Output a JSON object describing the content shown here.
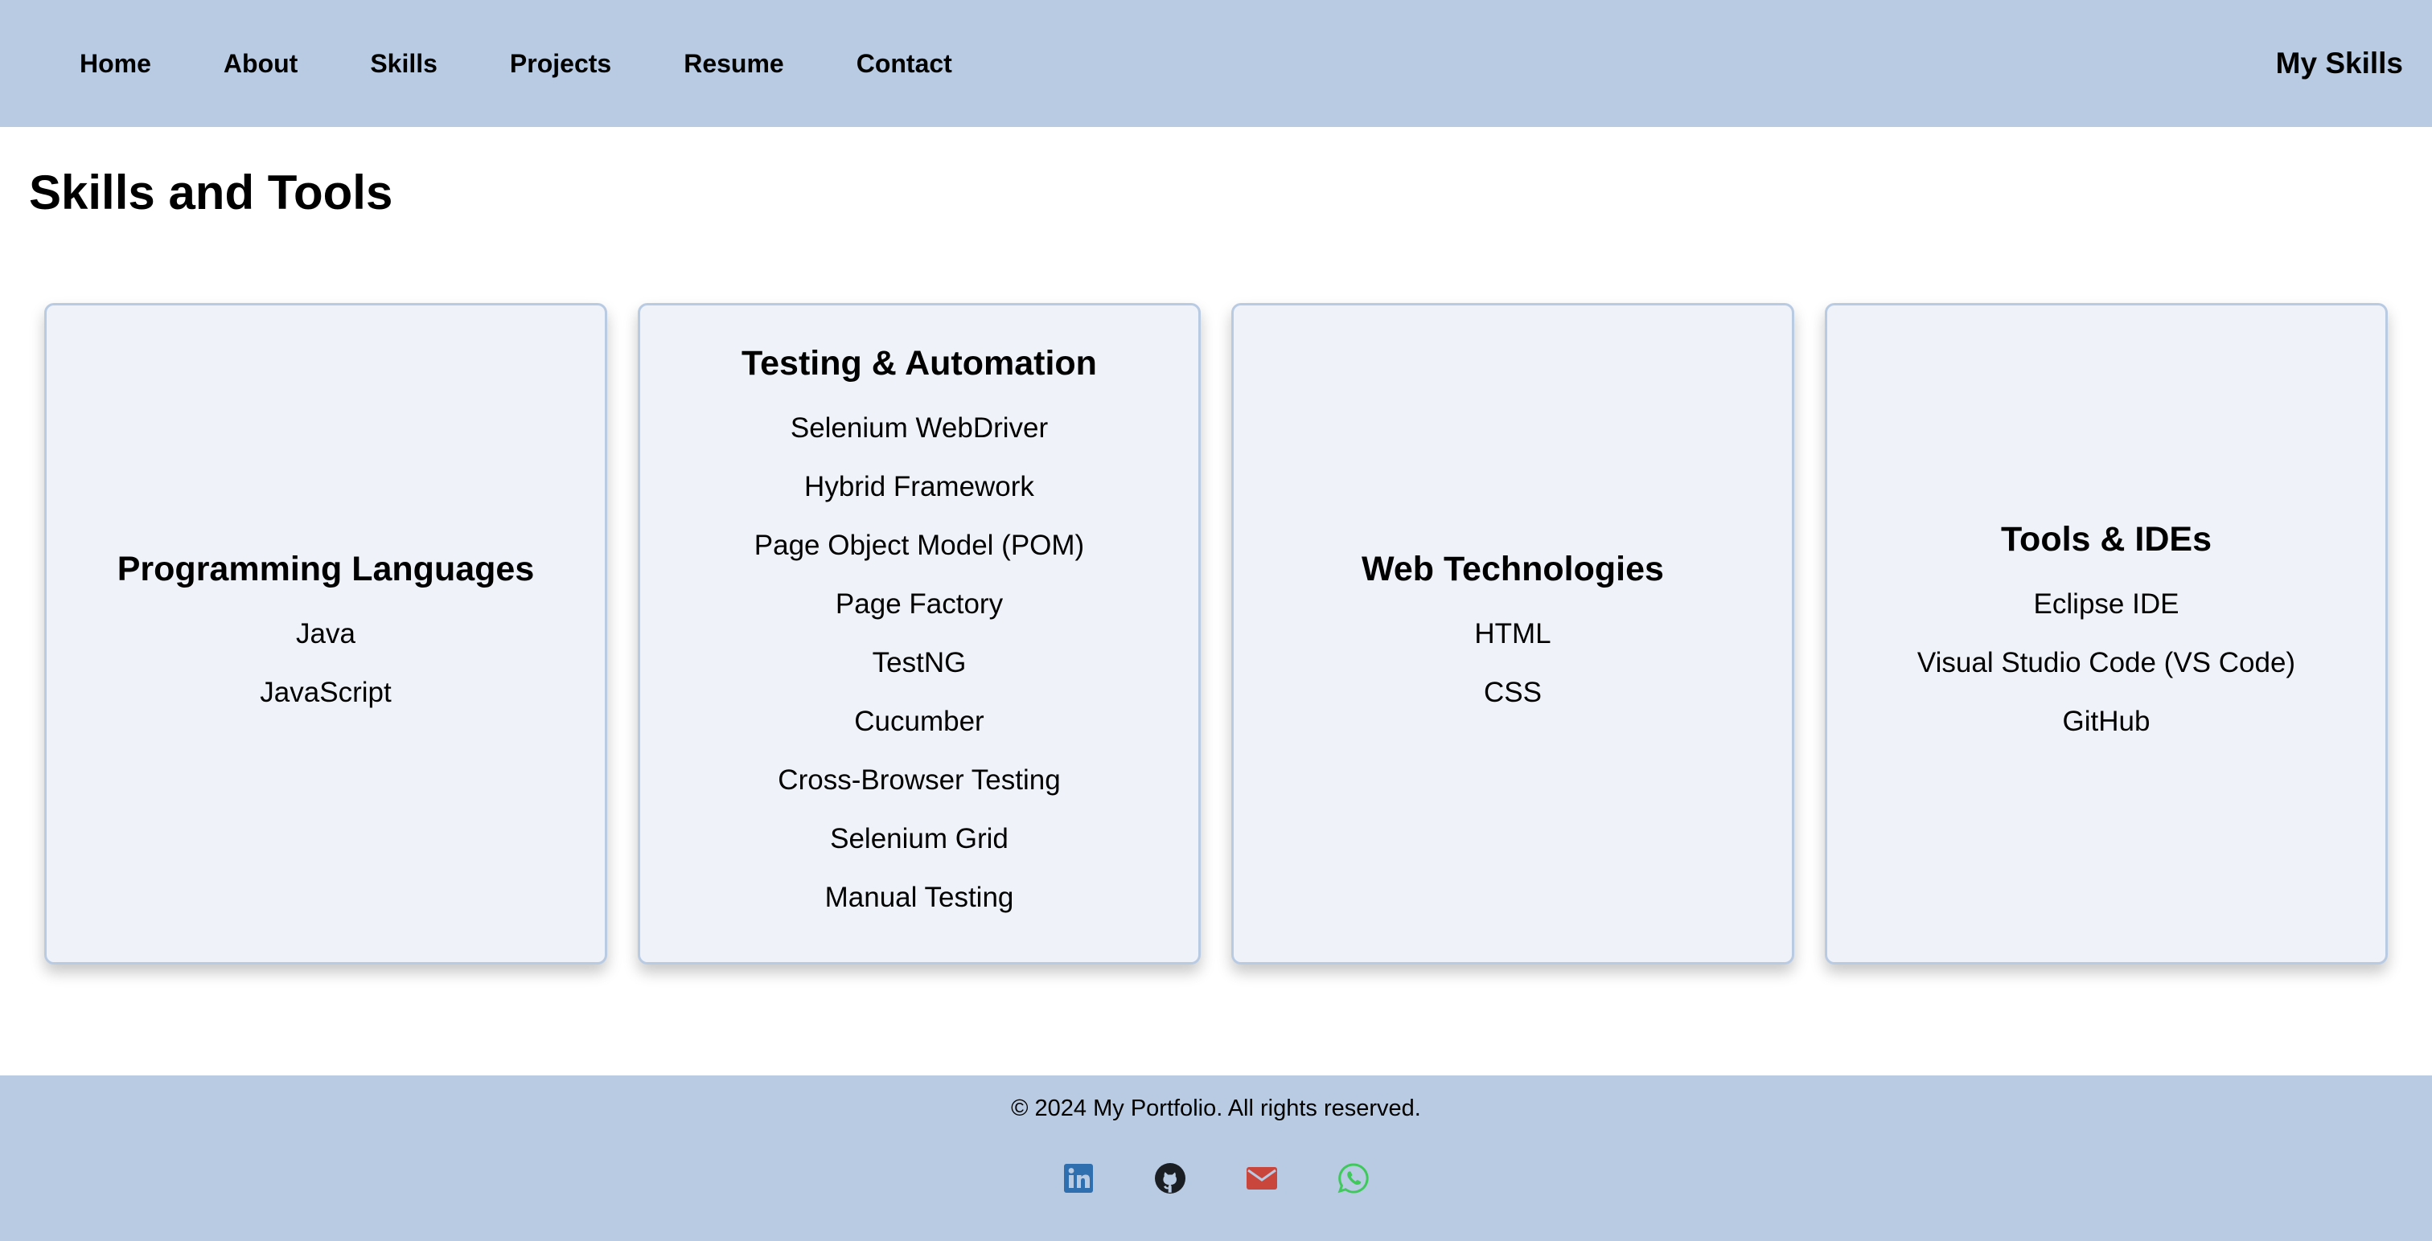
{
  "nav": {
    "links": [
      "Home",
      "About",
      "Skills",
      "Projects",
      "Resume",
      "Contact"
    ],
    "page_label": "My Skills"
  },
  "main": {
    "title": "Skills and Tools",
    "cards": [
      {
        "title": "Programming Languages",
        "items": [
          "Java",
          "JavaScript"
        ]
      },
      {
        "title": "Testing & Automation",
        "items": [
          "Selenium WebDriver",
          "Hybrid Framework",
          "Page Object Model (POM)",
          "Page Factory",
          "TestNG",
          "Cucumber",
          "Cross-Browser Testing",
          "Selenium Grid",
          "Manual Testing"
        ]
      },
      {
        "title": "Web Technologies",
        "items": [
          "HTML",
          "CSS"
        ]
      },
      {
        "title": "Tools & IDEs",
        "items": [
          "Eclipse IDE",
          "Visual Studio Code (VS Code)",
          "GitHub"
        ]
      }
    ]
  },
  "footer": {
    "copyright": "© 2024 My Portfolio. All rights reserved.",
    "social": [
      {
        "icon": "linkedin-icon",
        "color": "#2f6fb0"
      },
      {
        "icon": "github-icon",
        "color": "#1b1f23"
      },
      {
        "icon": "email-icon",
        "color": "#c9463d"
      },
      {
        "icon": "whatsapp-icon",
        "color": "#3ec95a"
      }
    ]
  },
  "colors": {
    "nav_bg": "#b9cbe3",
    "card_bg": "#eff3f9",
    "card_border": "#b9cbe3"
  }
}
